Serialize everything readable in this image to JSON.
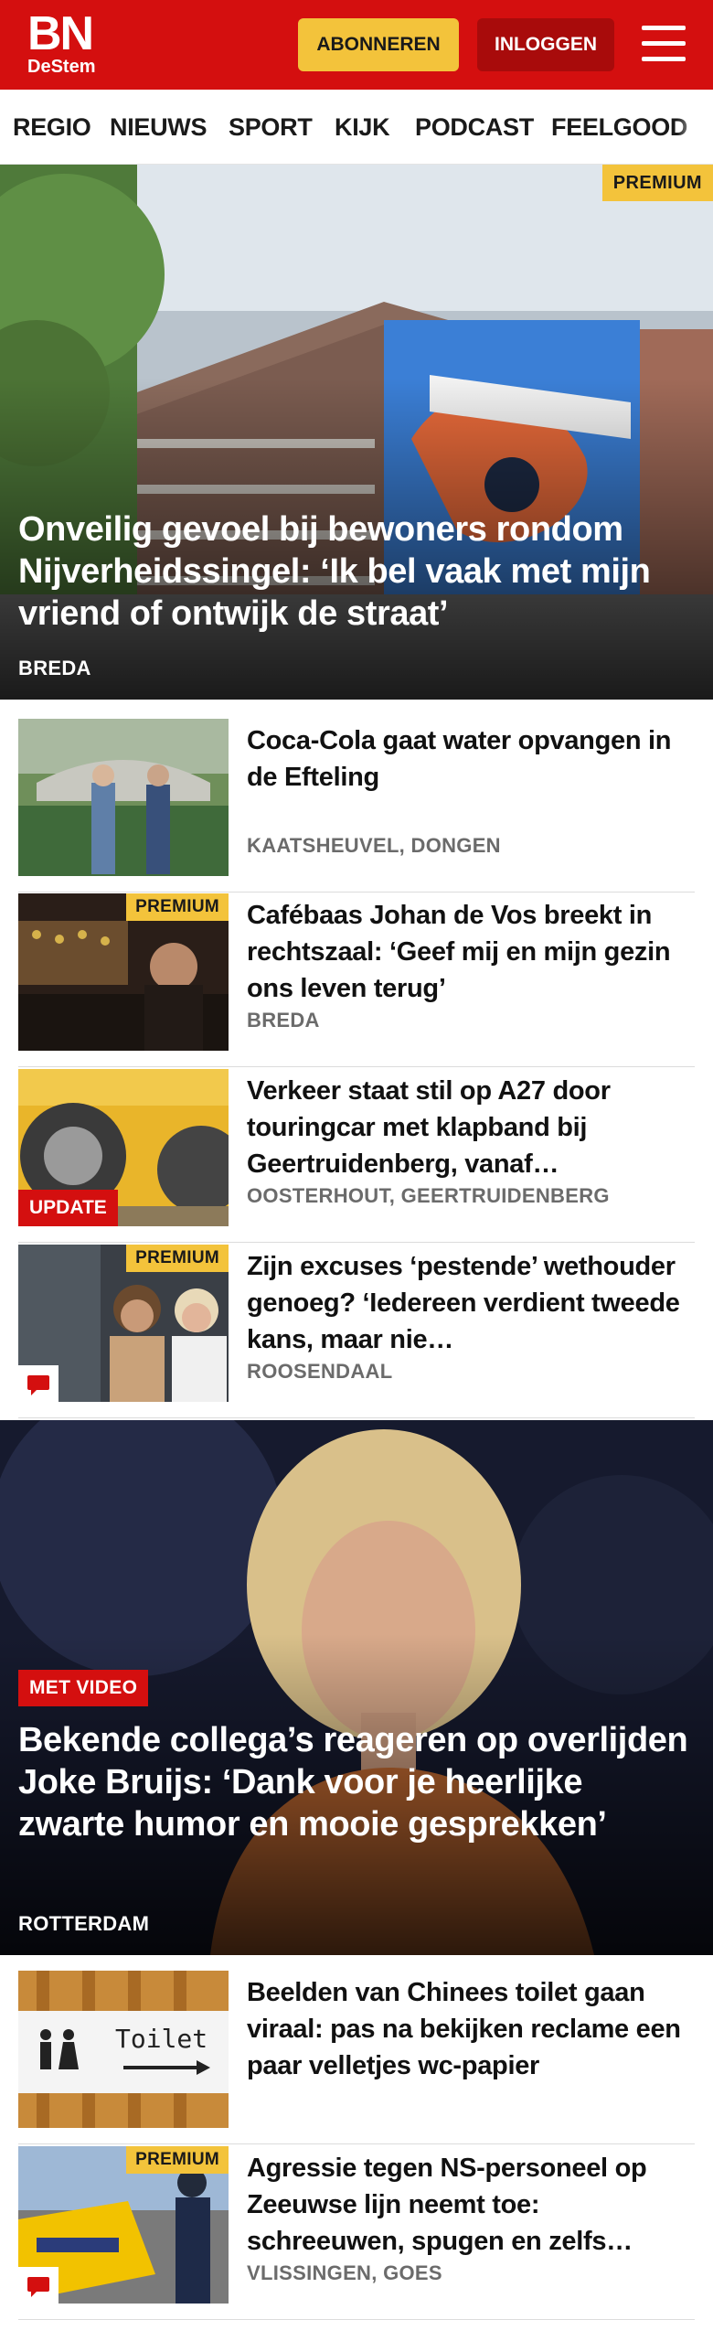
{
  "header": {
    "logo_main": "BN",
    "logo_sub": "DeStem",
    "subscribe_label": "ABONNEREN",
    "login_label": "INLOGGEN",
    "menu_icon": "hamburger-menu-icon",
    "brand_color": "#d40f0f",
    "accent_color": "#f3c33b"
  },
  "nav": {
    "items": [
      {
        "label": "REGIO"
      },
      {
        "label": "NIEUWS"
      },
      {
        "label": "SPORT"
      },
      {
        "label": "KIJK"
      },
      {
        "label": "PODCAST"
      },
      {
        "label": "FEELGOOD"
      }
    ]
  },
  "hero1": {
    "badge": "PREMIUM",
    "title": "Onveilig gevoel bij bewoners rondom Nijverheidssingel: ‘Ik bel vaak met mijn vriend of ontwijk de straat’",
    "location": "BREDA"
  },
  "list1": [
    {
      "title": "Coca-Cola gaat water opvangen in de Efteling",
      "location": "KAATSHEUVEL, DONGEN",
      "badge": "",
      "update": "",
      "comment_icon": ""
    },
    {
      "title": "Cafébaas Johan de Vos breekt in rechtszaal: ‘Geef mij en mijn gezin ons leven terug’",
      "location": "BREDA",
      "badge": "PREMIUM",
      "update": "",
      "comment_icon": ""
    },
    {
      "title": "Verkeer staat stil op A27 door touringcar met klapband bij Geertruidenberg, vanaf…",
      "location": "OOSTERHOUT, GEERTRUIDENBERG",
      "badge": "",
      "update": "UPDATE",
      "comment_icon": ""
    },
    {
      "title": "Zijn excuses ‘pestende’ wethouder genoeg? ‘Iedereen verdient tweede kans, maar nie…",
      "location": "ROOSENDAAL",
      "badge": "PREMIUM",
      "update": "",
      "comment_icon": "comment-icon"
    }
  ],
  "hero2": {
    "badge": "MET VIDEO",
    "title": "Bekende collega’s reageren op overlijden Joke Bruijs: ‘Dank voor je heerlijke zwarte humor en mooie gesprekken’",
    "location": "ROTTERDAM"
  },
  "list2": [
    {
      "title": "Beelden van Chinees toilet gaan viraal: pas na bekijken reclame een paar velletjes wc-papier",
      "location": "",
      "badge": "",
      "thumb_text": "Toilet"
    },
    {
      "title": "Agressie tegen NS-personeel op Zeeuwse lijn neemt toe: schreeuwen, spugen en zelfs…",
      "location": "VLISSINGEN, GOES",
      "badge": "PREMIUM",
      "comment_icon": "comment-icon"
    }
  ]
}
